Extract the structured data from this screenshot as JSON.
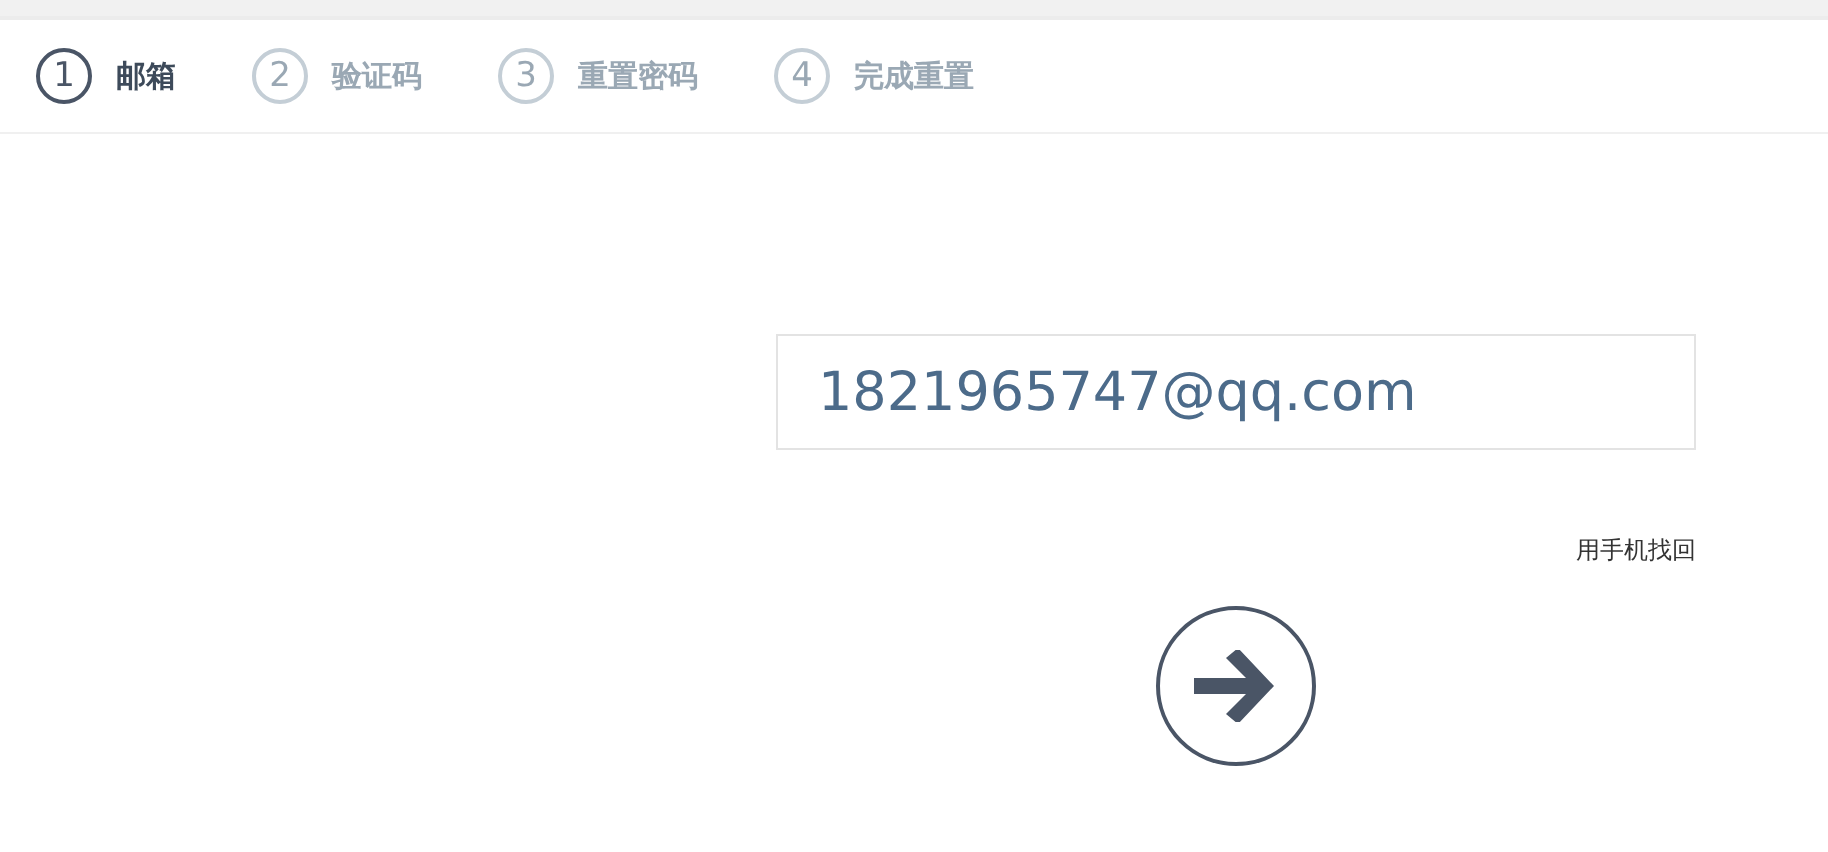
{
  "steps": [
    {
      "number": "1",
      "label": "邮箱",
      "selected": true
    },
    {
      "number": "2",
      "label": "验证码",
      "selected": false
    },
    {
      "number": "3",
      "label": "重置密码",
      "selected": false
    },
    {
      "number": "4",
      "label": "完成重置",
      "selected": false
    }
  ],
  "email_field": {
    "value": "1821965747@qq.com"
  },
  "phone_recovery_link": "用手机找回"
}
